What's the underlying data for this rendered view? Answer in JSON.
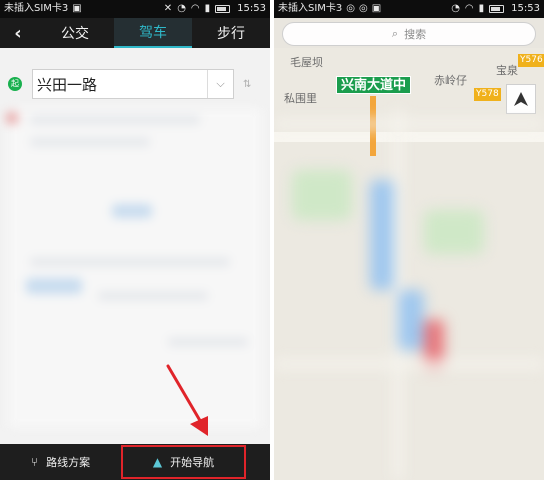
{
  "status_bar": {
    "left": {
      "carrier": "未插入SIM卡3",
      "time": "15:53"
    },
    "right": {
      "carrier": "未插入SIM卡3",
      "time": "15:53"
    }
  },
  "tabs": [
    {
      "label": "公交",
      "active": false
    },
    {
      "label": "驾车",
      "active": true
    },
    {
      "label": "步行",
      "active": false
    }
  ],
  "origin": {
    "badge": "起",
    "value": "兴田一路"
  },
  "bottom_bar": {
    "route_label": "路线方案",
    "nav_label": "开始导航"
  },
  "map": {
    "search_placeholder": "搜索",
    "labels": {
      "place_1": "毛屋坝",
      "place_2": "赤岭仔",
      "place_3": "宝泉",
      "place_4": "私围里",
      "place_tag": "兴南大道中",
      "badge_1": "Y576",
      "badge_2": "Y578"
    }
  },
  "colors": {
    "accent": "#2fb8c9",
    "nav_highlight": "#e0242a",
    "place_tag_bg": "#1b9d4d",
    "road_badge_bg": "#f0b11c"
  },
  "icons": {
    "back": "chevron-left-icon",
    "origin": "start-pin-icon",
    "dropdown": "chevron-down-icon",
    "swap": "swap-icon",
    "route": "route-fork-icon",
    "navigate": "navigation-arrow-icon",
    "search": "search-icon",
    "compass": "compass-icon"
  }
}
